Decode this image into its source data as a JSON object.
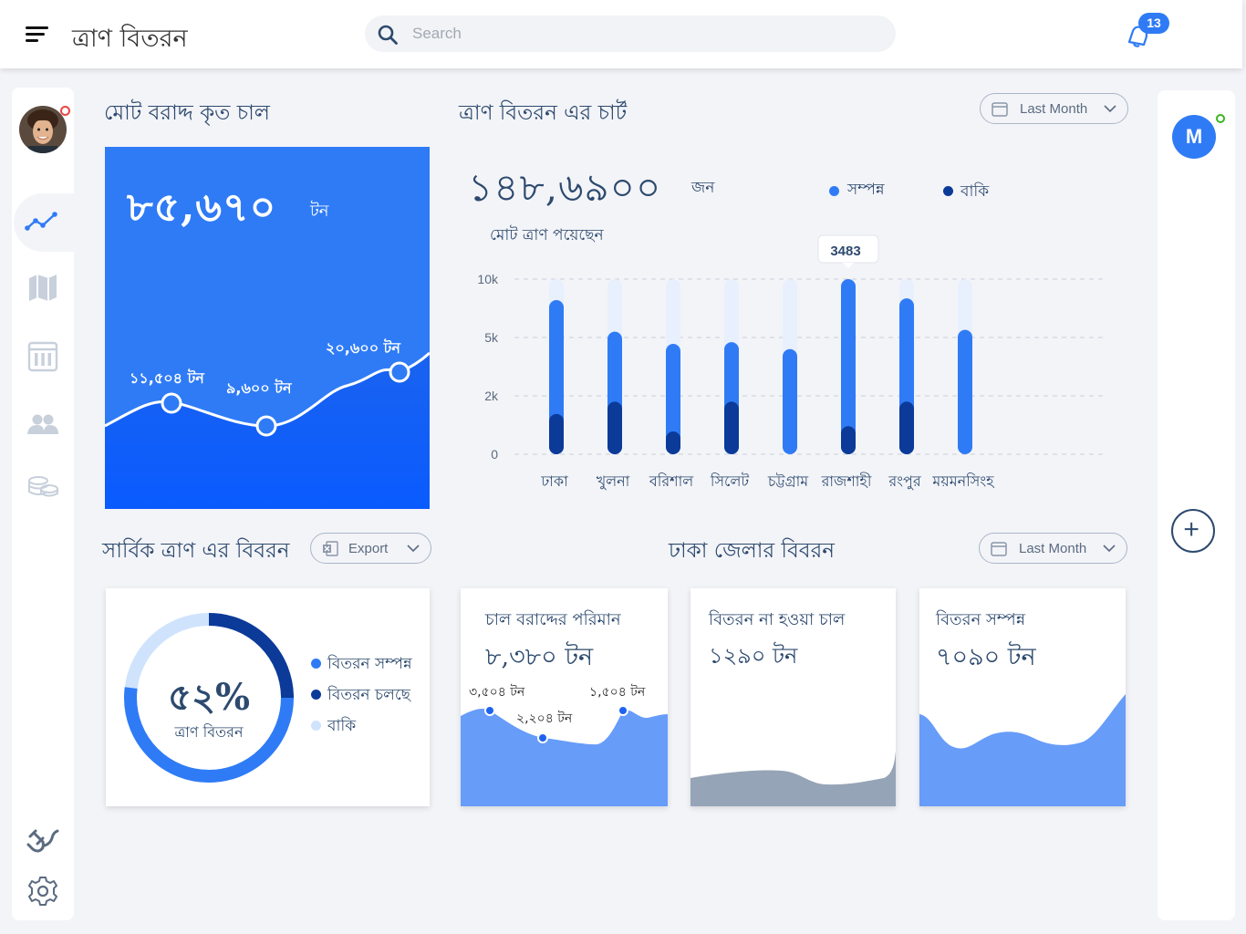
{
  "header": {
    "title": "ত্রাণ বিতরন",
    "search_placeholder": "Search",
    "notification_count": "13"
  },
  "icons": {
    "menu": "hamburger-menu-icon",
    "search": "search-icon",
    "bell": "bell-icon",
    "nav": [
      "analytics-icon",
      "map-icon",
      "calendar-icon",
      "users-icon",
      "coins-icon",
      "plug-icon",
      "gear-icon"
    ],
    "add": "plus-icon"
  },
  "colors": {
    "primary": "#2f7bf6",
    "dark": "#0b3a99",
    "light": "#e8f0fe",
    "text": "#2d4a6e"
  },
  "right_panel": {
    "avatar_initial": "M"
  },
  "rice_summary": {
    "title": "মোট বরাদ্দ কৃত চাল",
    "value": "৮৫,৬৭০",
    "unit": "টন",
    "points": [
      {
        "label": "১১,৫০৪ টন"
      },
      {
        "label": "৯,৬০০ টন"
      },
      {
        "label": "২০,৬০০ টন"
      }
    ]
  },
  "relief_chart": {
    "title": "ত্রাণ বিতরন এর চার্ট",
    "period": "Last Month",
    "total": "১৪৮,৬৯০০",
    "total_unit": "জন",
    "subtitle": "মোট ত্রাণ পয়েছেন",
    "legend": [
      {
        "label": "সম্পন্ন",
        "color": "#2f7bf6"
      },
      {
        "label": "বাকি",
        "color": "#0b3a99"
      }
    ],
    "tooltip": "3483"
  },
  "chart_data": {
    "type": "bar",
    "categories": [
      "ঢাকা",
      "খুলনা",
      "বরিশাল",
      "সিলেট",
      "চট্টগ্রাম",
      "রাজশাহী",
      "রংপুর",
      "ময়মনসিংহ"
    ],
    "y_tick_labels": [
      "0",
      "2k",
      "5k",
      "10k"
    ],
    "series": [
      {
        "name": "সম্পন্ন",
        "values": [
          8800,
          7000,
          6300,
          6400,
          6000,
          10000,
          8900,
          7100
        ]
      },
      {
        "name": "বাকি",
        "values": [
          2300,
          3000,
          1300,
          3000,
          0,
          1600,
          3000,
          0
        ]
      }
    ],
    "max_values": [
      10000,
      10000,
      10000,
      10000,
      10000,
      10000,
      10000,
      10000
    ],
    "grid": true
  },
  "overall": {
    "title": "সার্বিক ত্রাণ এর বিবরন",
    "export_label": "Export",
    "percent": "৫২%",
    "percent_value": 52,
    "caption": "ত্রাণ বিতরন",
    "legend": [
      {
        "label": "বিতরন সম্পন্ন",
        "color": "#2f7bf6"
      },
      {
        "label": "বিতরন চলছে",
        "color": "#0b3a99"
      },
      {
        "label": "বাকি",
        "color": "#cfe3fd"
      }
    ]
  },
  "dhaka": {
    "title": "ঢাকা জেলার বিবরন",
    "period": "Last Month",
    "cards": [
      {
        "title": "চাল বরাদ্দের পরিমান",
        "value": "৮,৩৮০ টন",
        "points": [
          "৩,৫০৪ টন",
          "২,২০৪ টন",
          "১,৫০৪ টন"
        ]
      },
      {
        "title": "বিতরন না হওয়া চাল",
        "value": "১২৯০ টন"
      },
      {
        "title": "বিতরন সম্পন্ন",
        "value": "৭০৯০ টন"
      }
    ]
  }
}
